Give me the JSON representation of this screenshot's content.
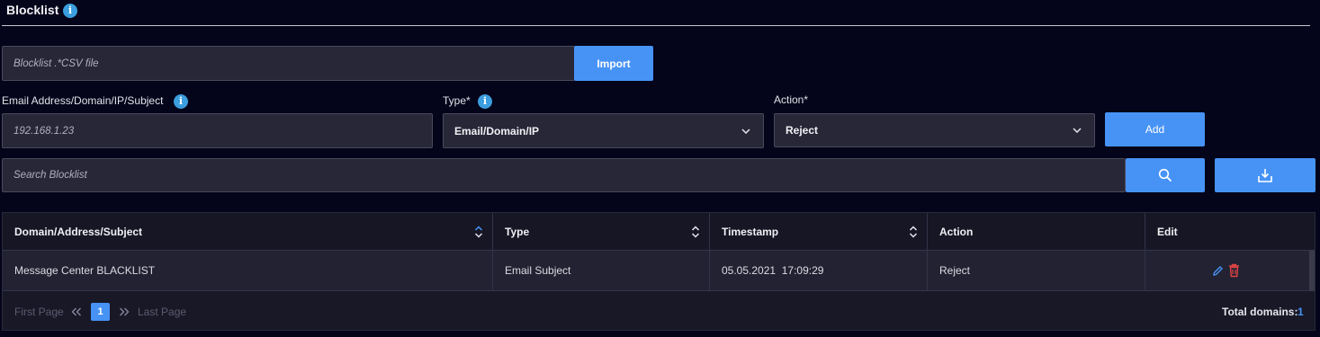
{
  "page": {
    "title": "Blocklist",
    "info_glyph": "i"
  },
  "import": {
    "file_placeholder": "Blocklist .*CSV file",
    "button_label": "Import"
  },
  "form": {
    "address_label": "Email Address/Domain/IP/Subject",
    "address_placeholder": "192.168.1.23",
    "type_label": "Type*",
    "type_value": "Email/Domain/IP",
    "action_label": "Action*",
    "action_value": "Reject",
    "add_label": "Add"
  },
  "search": {
    "placeholder": "Search Blocklist",
    "search_icon": "search-icon",
    "download_icon": "download-icon"
  },
  "table": {
    "columns": [
      "Domain/Address/Subject",
      "Type",
      "Timestamp",
      "Action",
      "Edit"
    ],
    "rows": [
      {
        "domain": "Message Center BLACKLIST",
        "type": "Email Subject",
        "timestamp": "05.05.2021  17:09:29",
        "action": "Reject"
      }
    ]
  },
  "pager": {
    "first": "First Page",
    "last": "Last Page",
    "current": "1",
    "total_label": "Total domains:",
    "total_value": "1"
  },
  "colors": {
    "background": "#04041a",
    "accent": "#4793f5",
    "info": "#3b9ede",
    "delete": "#e04444"
  }
}
